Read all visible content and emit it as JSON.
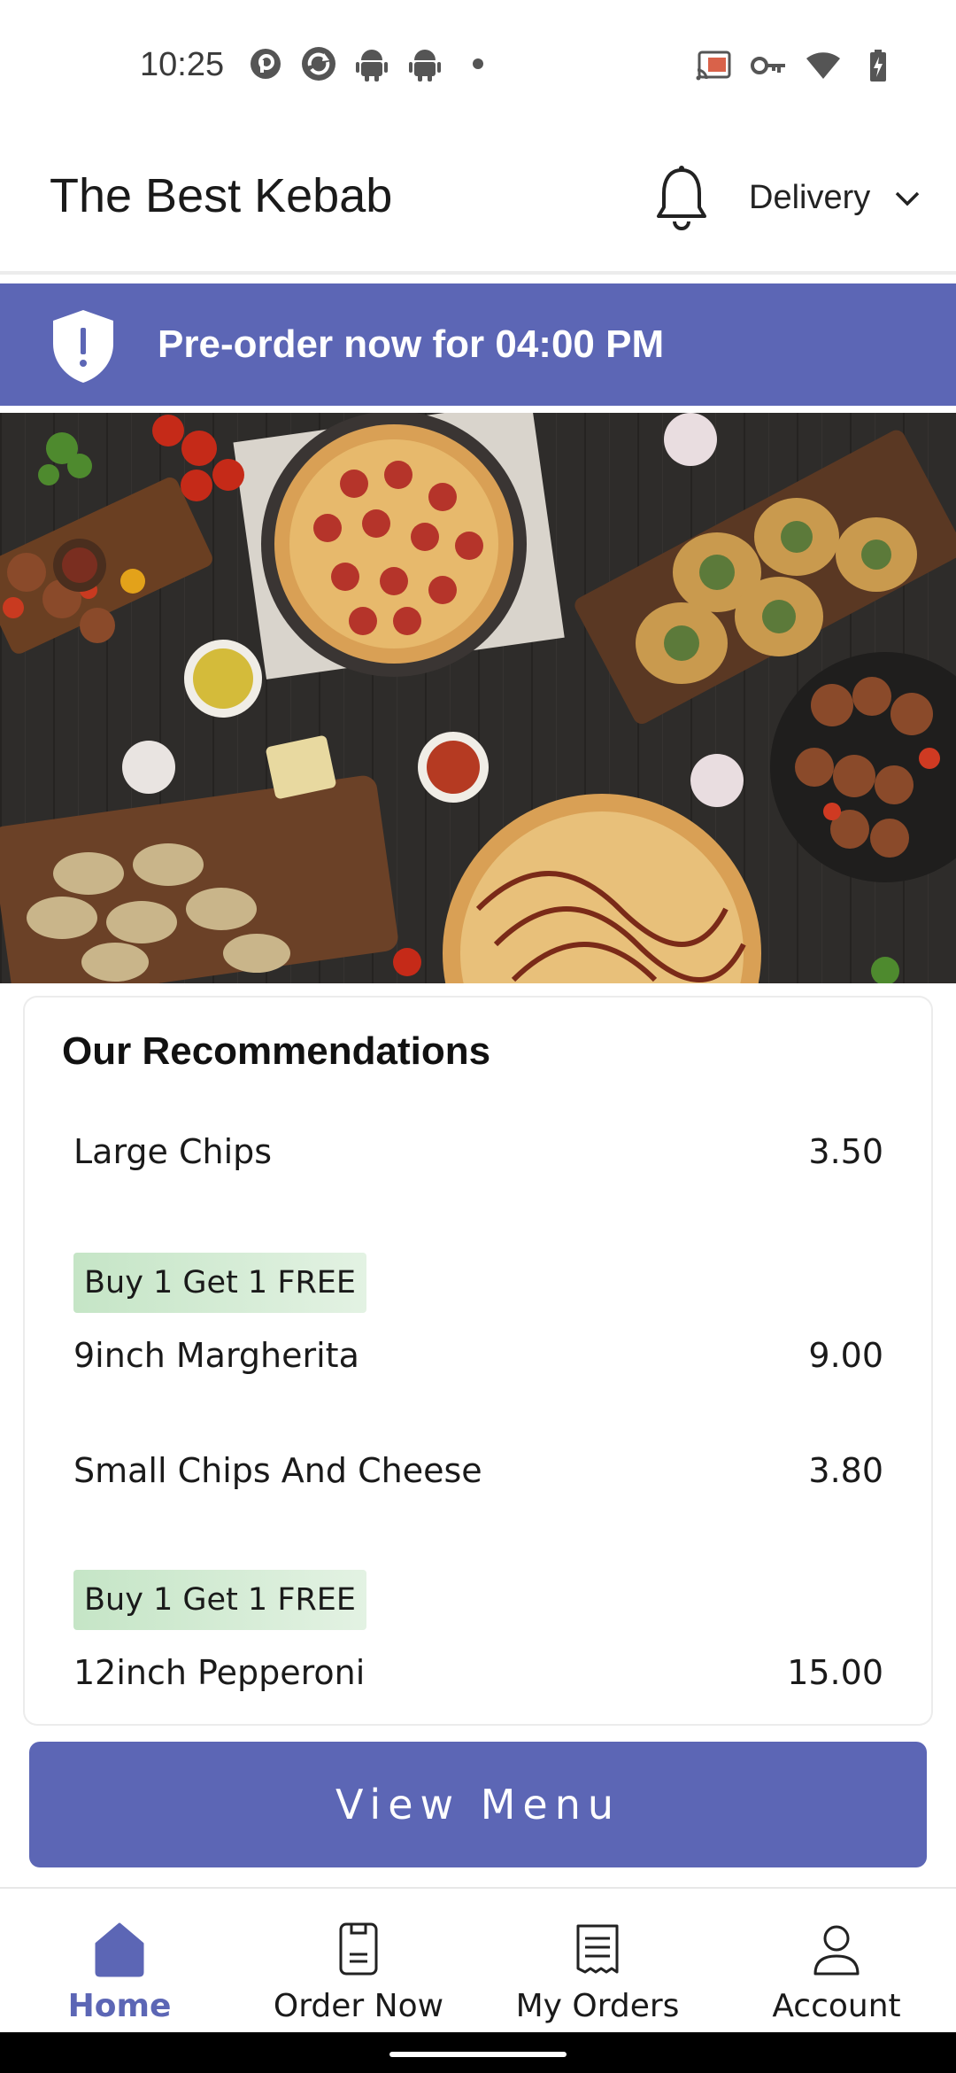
{
  "status_bar": {
    "time": "10:25",
    "left_icons": [
      "pocketcasts-icon",
      "sync-icon",
      "android-icon",
      "android-icon",
      "dot-icon"
    ],
    "right_icons": [
      "cast-icon",
      "vpn-key-icon",
      "wifi-icon",
      "battery-charging-icon"
    ]
  },
  "header": {
    "title": "The Best Kebab",
    "notification_icon": "bell-icon",
    "mode_label": "Delivery",
    "mode_icon": "chevron-down-icon"
  },
  "banner": {
    "icon": "shield-alert-icon",
    "text": "Pre-order now for 04:00 PM"
  },
  "hero": {
    "icon": "food-photo"
  },
  "recommendations": {
    "title": "Our Recommendations",
    "items": [
      {
        "name": "Large Chips",
        "price": "3.50",
        "promo": ""
      },
      {
        "name": "9inch Margherita",
        "price": "9.00",
        "promo": "Buy 1 Get 1 FREE"
      },
      {
        "name": "Small Chips And Cheese",
        "price": "3.80",
        "promo": ""
      },
      {
        "name": "12inch Pepperoni",
        "price": "15.00",
        "promo": "Buy 1 Get 1 FREE"
      }
    ]
  },
  "view_menu_label": "View Menu",
  "bottom_nav": [
    {
      "label": "Home",
      "icon": "home-icon",
      "active": true
    },
    {
      "label": "Order Now",
      "icon": "order-now-icon",
      "active": false
    },
    {
      "label": "My Orders",
      "icon": "receipt-icon",
      "active": false
    },
    {
      "label": "Account",
      "icon": "account-icon",
      "active": false
    }
  ],
  "colors": {
    "accent": "#5c66b5",
    "promo_bg": "#c5e5c6"
  }
}
